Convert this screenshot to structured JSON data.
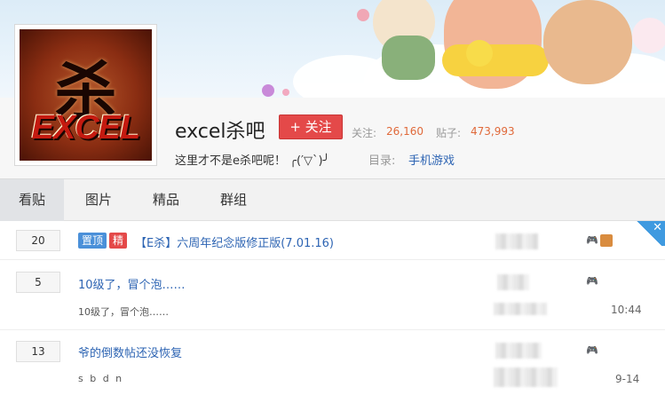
{
  "forum": {
    "name": "excel杀吧",
    "follow_label": "+ 关注",
    "followers_label": "关注:",
    "followers": "26,160",
    "posts_label": "贴子:",
    "posts": "473,993",
    "slogan": "这里才不是e杀吧呢！ ╭(′▽`)╯",
    "directory_label": "目录:",
    "directory": "手机游戏"
  },
  "logo": {
    "char": "杀",
    "word": "EXCEL"
  },
  "tabs": [
    {
      "label": "看贴",
      "active": true
    },
    {
      "label": "图片",
      "active": false
    },
    {
      "label": "精品",
      "active": false
    },
    {
      "label": "群组",
      "active": false
    }
  ],
  "threads": [
    {
      "replies": "20",
      "badges": [
        "置顶",
        "精"
      ],
      "title": "【E杀】六周年纪念版修正版(7.01.16)",
      "abstract": "",
      "time": ""
    },
    {
      "replies": "5",
      "badges": [],
      "title": "10级了，冒个泡……",
      "abstract": "10级了，冒个泡……",
      "time": "10:44"
    },
    {
      "replies": "13",
      "badges": [],
      "title": "爷的倒数帖还没恢复",
      "abstract": "s b d n",
      "time": "9-14"
    }
  ],
  "colors": {
    "accent_red": "#e44949",
    "link_blue": "#2d64b3",
    "stat_orange": "#e0693a",
    "badge_top": "#4a90d9",
    "badge_good": "#e44949"
  },
  "icons": {
    "game": "game-controller-icon",
    "gift": "gift-icon",
    "close": "close-icon"
  }
}
